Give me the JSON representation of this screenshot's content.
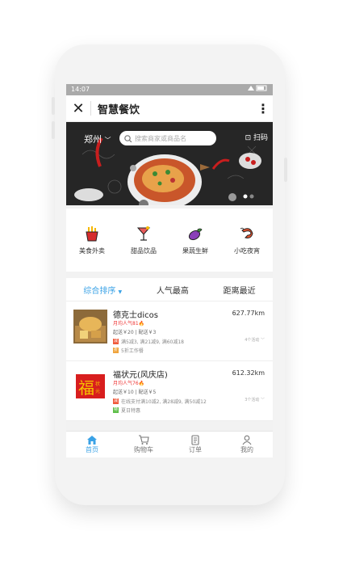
{
  "status": {
    "time": "14:07"
  },
  "header": {
    "title": "智慧餐饮"
  },
  "banner": {
    "city": "郑州",
    "search_placeholder": "搜索商家或商品名",
    "scan_label": "扫码"
  },
  "categories": [
    {
      "label": "美食外卖",
      "icon": "fries-icon"
    },
    {
      "label": "甜品饮品",
      "icon": "cocktail-icon"
    },
    {
      "label": "果蔬生鲜",
      "icon": "eggplant-icon"
    },
    {
      "label": "小吃夜宵",
      "icon": "shrimp-icon"
    }
  ],
  "sort": {
    "comprehensive": "综合排序",
    "popular": "人气最高",
    "nearest": "距离最近"
  },
  "shops": [
    {
      "name": "德克士dicos",
      "distance": "627.77km",
      "sales": "月均人气81",
      "delivery": "起送￥20 | 配送￥3",
      "promo1_badge": "减",
      "promo1": "满5减3, 满21减9, 满60减18",
      "promo2_badge": "折",
      "promo2": "5折工作餐",
      "activity": "4个活动"
    },
    {
      "name": "福状元(风庆店)",
      "distance": "612.32km",
      "sales": "月均人气76",
      "delivery": "起送￥10 | 配送￥5",
      "promo1_badge": "减",
      "promo1": "在线支付满10减2, 满28减9, 满50减12",
      "promo2_badge": "特",
      "promo2": "夏日特惠",
      "activity": "3个活动",
      "logo_text": "福状元"
    }
  ],
  "tabs": {
    "home": "首页",
    "cart": "购物车",
    "orders": "订单",
    "mine": "我的"
  },
  "colors": {
    "accent": "#3aa2e6",
    "status_bar": "#aaaaaa",
    "sales_red": "#e33333"
  }
}
